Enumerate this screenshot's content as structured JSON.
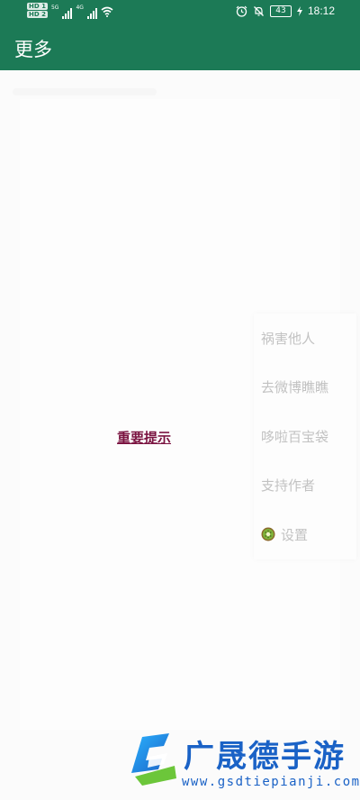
{
  "status_bar": {
    "hd_1": "HD 1",
    "hd_2": "HD 2",
    "net_1": "5G",
    "net_2": "4G",
    "battery": "43",
    "time": "18:12"
  },
  "app_bar": {
    "title": "更多"
  },
  "main": {
    "notice_link": "重要提示"
  },
  "menu": {
    "items": [
      {
        "label": "祸害他人"
      },
      {
        "label": "去微博瞧瞧"
      },
      {
        "label": "哆啦百宝袋"
      },
      {
        "label": "支持作者"
      },
      {
        "label": "设置",
        "icon": "kiwi-icon"
      }
    ]
  },
  "watermark": {
    "title": "广晟德手游",
    "url": "www.gsdtiepianji.com"
  },
  "colors": {
    "primary": "#1c7a56",
    "link": "#7a1340",
    "menu_text": "#c2c2c2",
    "watermark": "#1a62c6"
  }
}
